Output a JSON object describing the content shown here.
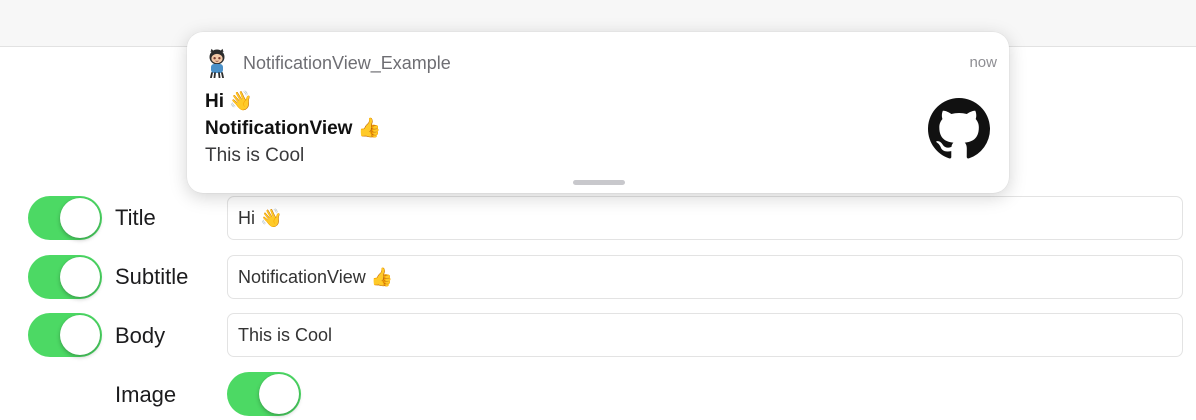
{
  "notification": {
    "app_name": "NotificationView_Example",
    "timestamp": "now",
    "title": "Hi 👋",
    "subtitle": "NotificationView 👍",
    "body": "This is Cool",
    "app_icon": "octocat-icon",
    "attachment_icon": "github-logo-icon"
  },
  "form": {
    "title_row": {
      "label": "Title",
      "enabled": true,
      "value": "Hi 👋"
    },
    "subtitle_row": {
      "label": "Subtitle",
      "enabled": true,
      "value": "NotificationView 👍"
    },
    "body_row": {
      "label": "Body",
      "enabled": true,
      "value": "This is Cool"
    },
    "image_row": {
      "label": "Image",
      "enabled": true
    }
  },
  "colors": {
    "toggle_on": "#4cd964",
    "navbar_bg": "#f7f7f7"
  }
}
